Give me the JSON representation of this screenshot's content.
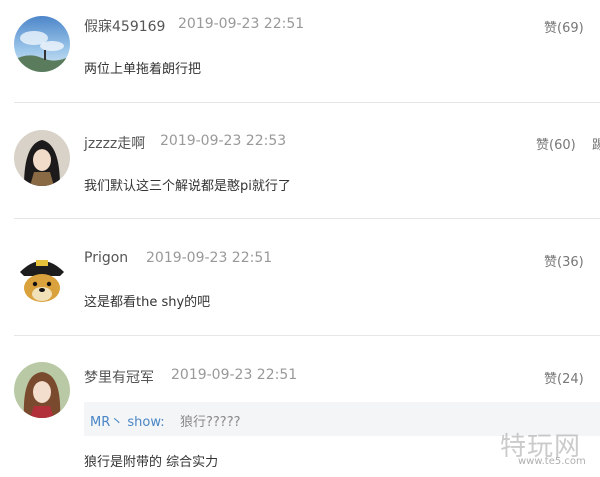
{
  "comments": [
    {
      "username": "假寐459169",
      "time": "2019-09-23 22:51",
      "likes_label": "赞(69)",
      "content": "两位上单拖着朗行把",
      "avatar": "avatar-sky-landscape"
    },
    {
      "username": "jzzzz走啊",
      "time": "2019-09-23 22:53",
      "likes_label": "赞(60)",
      "content": "我们默认这三个解说都是憨pi就行了",
      "avatar": "avatar-dark-hair-anime"
    },
    {
      "username": "Prigon",
      "time": "2019-09-23 22:51",
      "likes_label": "赞(36)",
      "content": "这是都看the shy的吧",
      "avatar": "avatar-dog-pirate-hat"
    },
    {
      "username": "梦里有冠军",
      "time": "2019-09-23 22:51",
      "likes_label": "赞(24)",
      "content": "狼行是附带的 综合实力",
      "avatar": "avatar-girl-brown-hair",
      "reply_quote": {
        "who": "MR丶 show:",
        "text": "狼行?????"
      }
    }
  ],
  "partial_text": "踢",
  "watermark": {
    "logo": "特玩网",
    "url": "www.te5.com"
  }
}
